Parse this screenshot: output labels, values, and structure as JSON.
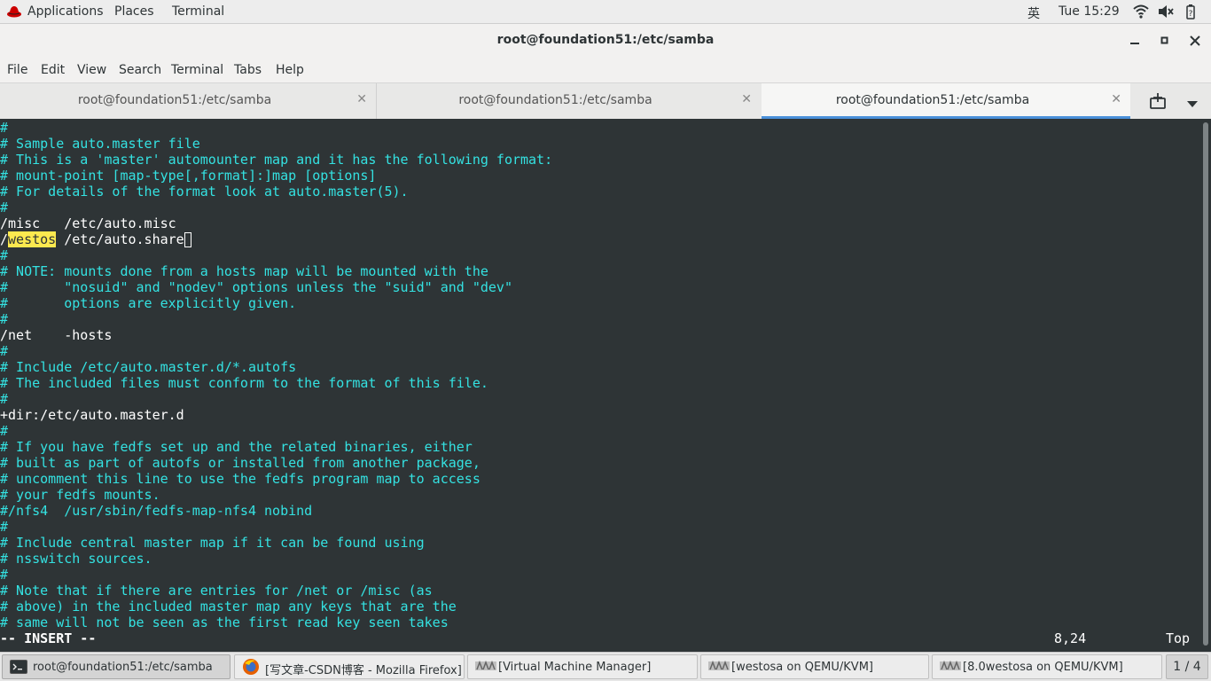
{
  "top_panel": {
    "applications": "Applications",
    "places": "Places",
    "terminal": "Terminal",
    "input_method": "英",
    "clock": "Tue 15:29",
    "status_icons": [
      "network-wireless-icon",
      "volume-muted-icon",
      "battery-icon",
      "help-icon"
    ]
  },
  "window": {
    "title": "root@foundation51:/etc/samba"
  },
  "menu": [
    "File",
    "Edit",
    "View",
    "Search",
    "Terminal",
    "Tabs",
    "Help"
  ],
  "tabs": [
    {
      "label": "root@foundation51:/etc/samba",
      "active": false
    },
    {
      "label": "root@foundation51:/etc/samba",
      "active": false
    },
    {
      "label": "root@foundation51:/etc/samba",
      "active": true
    }
  ],
  "terminal": {
    "lines": [
      "#",
      "# Sample auto.master file",
      "# This is a 'master' automounter map and it has the following format:",
      "# mount-point [map-type[,format]:]map [options]",
      "# For details of the format look at auto.master(5).",
      "#",
      "/misc   /etc/auto.misc",
      "/westos /etc/auto.share",
      "#",
      "# NOTE: mounts done from a hosts map will be mounted with the",
      "#       \"nosuid\" and \"nodev\" options unless the \"suid\" and \"dev\"",
      "#       options are explicitly given.",
      "#",
      "/net    -hosts",
      "#",
      "# Include /etc/auto.master.d/*.autofs",
      "# The included files must conform to the format of this file.",
      "#",
      "+dir:/etc/auto.master.d",
      "#",
      "# If you have fedfs set up and the related binaries, either",
      "# built as part of autofs or installed from another package,",
      "# uncomment this line to use the fedfs program map to access",
      "# your fedfs mounts.",
      "#/nfs4  /usr/sbin/fedfs-map-nfs4 nobind",
      "#",
      "# Include central master map if it can be found using",
      "# nsswitch sources.",
      "#",
      "# Note that if there are entries for /net or /misc (as",
      "# above) in the included master map any keys that are the",
      "# same will not be seen as the first read key seen takes"
    ],
    "highlight_word": "westos",
    "mode": "-- INSERT --",
    "position": "8,24",
    "scroll_status": "Top"
  },
  "taskbar": {
    "items": [
      {
        "label": "root@foundation51:/etc/samba",
        "icon": "terminal-icon",
        "active": true
      },
      {
        "label": "[写文章-CSDN博客 - Mozilla Firefox]",
        "icon": "firefox-icon",
        "active": false
      },
      {
        "label": "[Virtual Machine Manager]",
        "icon": "virt-manager-icon",
        "active": false
      },
      {
        "label": "[westosa on QEMU/KVM]",
        "icon": "virt-manager-icon",
        "active": false
      },
      {
        "label": "[8.0westosa on QEMU/KVM]",
        "icon": "virt-manager-icon",
        "active": false
      }
    ],
    "workspace": "1 / 4"
  }
}
